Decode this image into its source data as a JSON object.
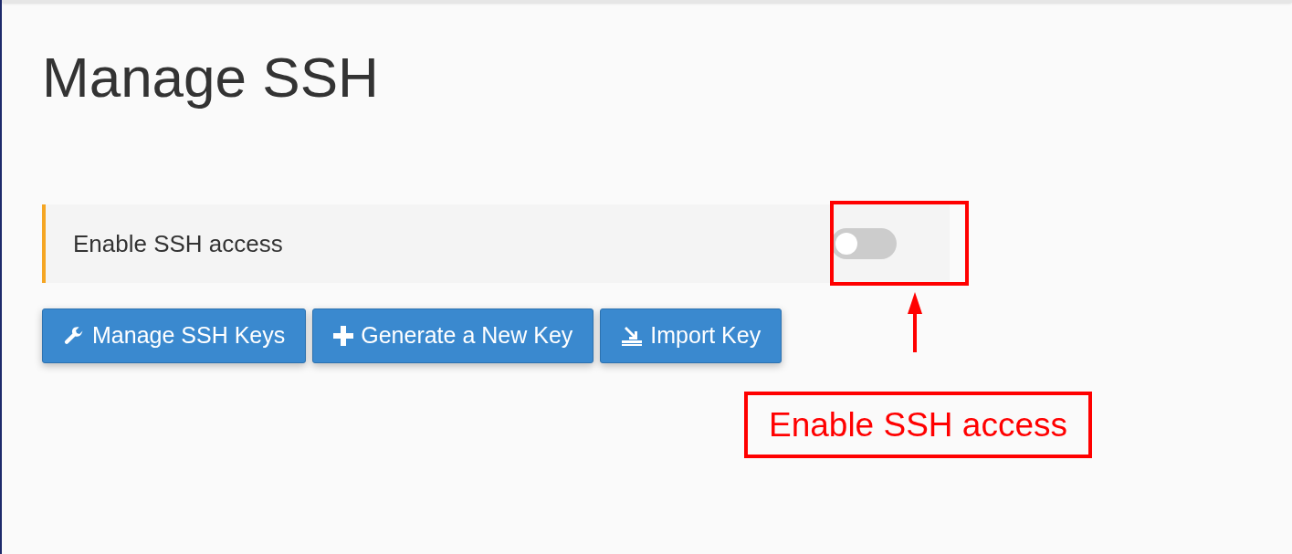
{
  "title": "Manage SSH",
  "setting": {
    "label": "Enable SSH access",
    "on": false
  },
  "buttons": [
    {
      "kind": "wrench",
      "label": "Manage SSH Keys"
    },
    {
      "kind": "plus",
      "label": "Generate a New Key"
    },
    {
      "kind": "import",
      "label": "Import Key"
    }
  ],
  "annotation": {
    "label": "Enable SSH access"
  }
}
